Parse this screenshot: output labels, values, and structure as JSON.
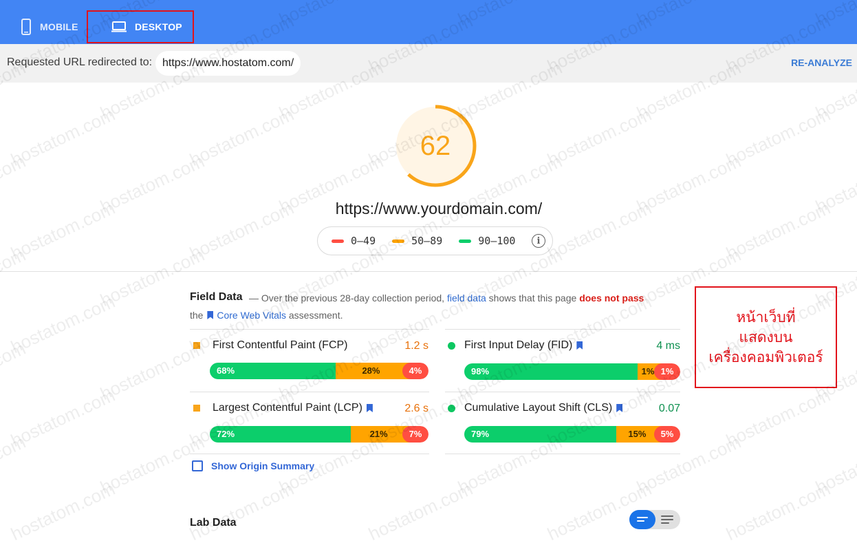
{
  "tabs": {
    "mobile_label": "MOBILE",
    "desktop_label": "DESKTOP"
  },
  "url_bar": {
    "label": "Requested URL redirected to:",
    "url": "https://www.hostatom.com/",
    "reanalyze": "RE-ANALYZE"
  },
  "score": {
    "value": "62",
    "fraction": 0.62,
    "color": "#f9a51a"
  },
  "site_url": "https://www.yourdomain.com/",
  "legend": {
    "ranges": [
      {
        "label": "0–49",
        "color": "#ff4e42"
      },
      {
        "label": "50–89",
        "color": "#ffa400"
      },
      {
        "label": "90–100",
        "color": "#0cce6b"
      }
    ],
    "info_icon": "i"
  },
  "field_data": {
    "title": "Field Data",
    "desc_prefix": "— Over the previous 28-day collection period,",
    "desc_link": "field data",
    "desc_mid": "shows that this page",
    "desc_fail": "does not pass",
    "desc2_prefix": "the",
    "desc2_link": "Core Web Vitals",
    "desc2_suffix": "assessment.",
    "metrics": [
      {
        "name": "First Contentful Paint (FCP)",
        "value": "1.2 s",
        "value_color": "#e8710a",
        "good": "68%",
        "avg": "28%",
        "poor": "4%",
        "good_frac": 0.68,
        "avg_frac": 0.28,
        "poor_frac": 0.04
      },
      {
        "name": "First Input Delay (FID)",
        "value": "4 ms",
        "value_color": "#0d904f",
        "good": "98%",
        "avg": "1%",
        "poor": "1%",
        "good_frac": 0.98,
        "avg_frac": 0.01,
        "poor_frac": 0.01
      },
      {
        "name": "Largest Contentful Paint (LCP)",
        "value": "2.6 s",
        "value_color": "#e8710a",
        "good": "72%",
        "avg": "21%",
        "poor": "7%",
        "good_frac": 0.72,
        "avg_frac": 0.21,
        "poor_frac": 0.07
      },
      {
        "name": "Cumulative Layout Shift (CLS)",
        "value": "0.07",
        "value_color": "#0d904f",
        "good": "79%",
        "avg": "15%",
        "poor": "5%",
        "good_frac": 0.79,
        "avg_frac": 0.15,
        "poor_frac": 0.05
      }
    ],
    "show_origin": "Show Origin Summary"
  },
  "lab_data": {
    "title": "Lab Data"
  },
  "annotation": "หน้าเว็บที่\nแสดงบน\nเครื่องคอมพิวเตอร์",
  "watermark": "hostatom.com"
}
